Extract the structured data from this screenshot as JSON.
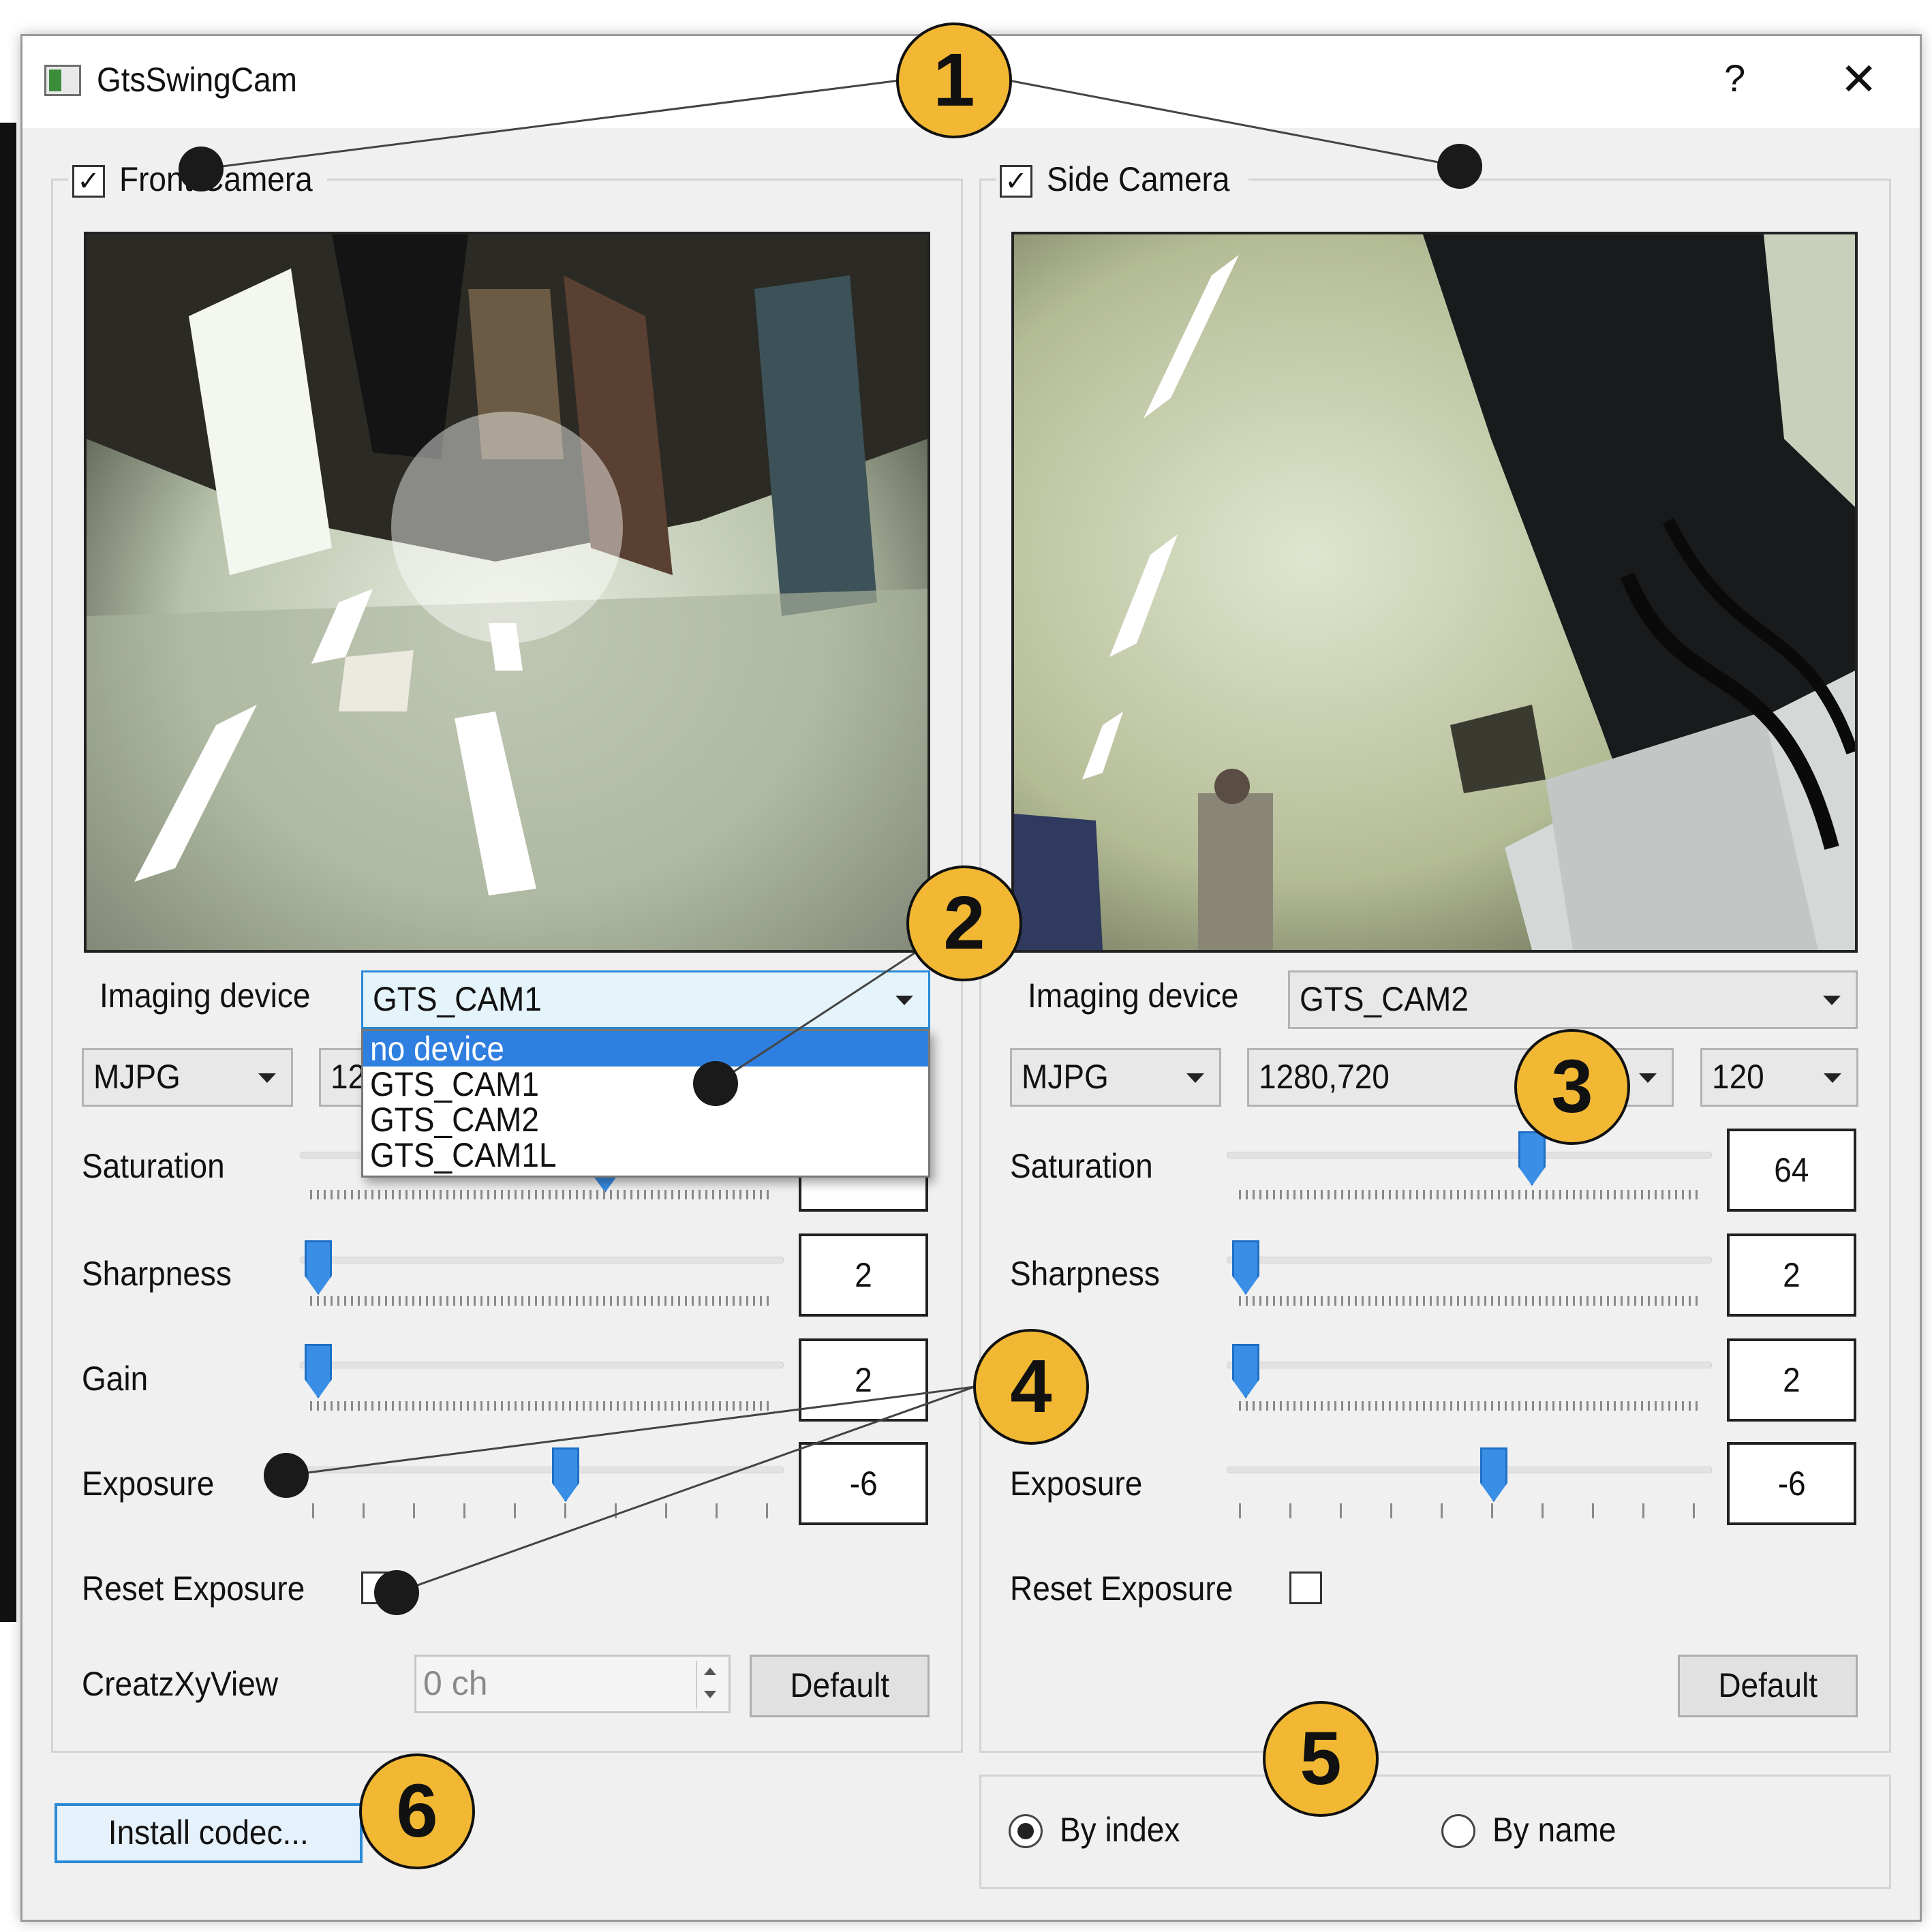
{
  "window": {
    "title": "GtsSwingCam",
    "help_label": "?",
    "close_label": "✕"
  },
  "front": {
    "title": "Front Camera",
    "checked": "✓",
    "imaging_label": "Imaging device",
    "device": "GTS_CAM1",
    "format": "MJPG",
    "resolution_partial": "12",
    "saturation_label": "Saturation",
    "saturation_value": "",
    "saturation_level": 0.63,
    "sharpness_label": "Sharpness",
    "sharpness_value": "2",
    "gain_label": "Gain",
    "gain_value": "2",
    "exposure_label": "Exposure",
    "exposure_value": "-6",
    "reset_label": "Reset Exposure",
    "creatz_label": "CreatzXyView",
    "creatz_value": "0 ch",
    "default_label": "Default",
    "dropdown_options": [
      "no device",
      "GTS_CAM1",
      "GTS_CAM2",
      "GTS_CAM1L"
    ]
  },
  "side": {
    "title": "Side Camera",
    "checked": "✓",
    "imaging_label": "Imaging device",
    "device": "GTS_CAM2",
    "format": "MJPG",
    "resolution": "1280,720",
    "fps": "120",
    "saturation_label": "Saturation",
    "saturation_value": "64",
    "sharpness_label": "Sharpness",
    "sharpness_value": "2",
    "gain_value": "2",
    "exposure_label": "Exposure",
    "exposure_value": "-6",
    "reset_label": "Reset Exposure",
    "default_label": "Default"
  },
  "bottom": {
    "install_codec_label": "Install codec...",
    "by_index_label": "By index",
    "by_name_label": "By name"
  },
  "badges": [
    "1",
    "2",
    "3",
    "4",
    "5",
    "6"
  ],
  "colors": {
    "badge": "#f2b833",
    "accent": "#2f7fe0",
    "slider_handle": "#3a8ee6"
  }
}
